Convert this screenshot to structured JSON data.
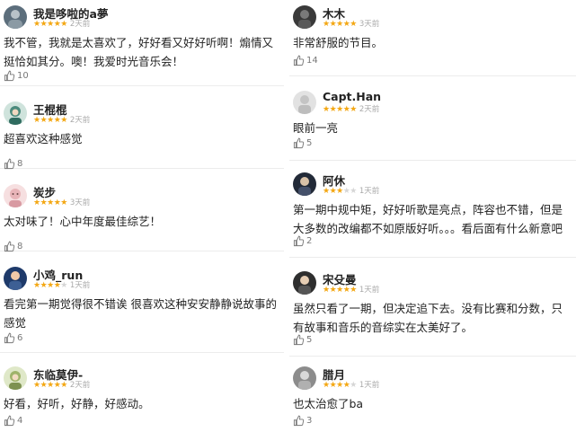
{
  "left": [
    {
      "user": "我是哆啦的a夢",
      "time": "2天前",
      "stars": 5,
      "text": "我不管，我就是太喜欢了，好好看又好好听啊！煽情又挺恰如其分。噢！我爱时光音乐会！",
      "likes": "10",
      "avatar_color": "#5c6e7c"
    },
    {
      "user": "王棍棍",
      "time": "2天前",
      "stars": 5,
      "text": "超喜欢这种感觉",
      "likes": "8",
      "avatar_color": "#4a8a7c"
    },
    {
      "user": "炭步",
      "time": "3天前",
      "stars": 5,
      "text": "太对味了！心中年度最佳综艺！",
      "likes": "8",
      "avatar_color": "#e8b4b8"
    },
    {
      "user": "小鸡_run",
      "time": "1天前",
      "stars": 4,
      "text": "看完第一期觉得很不错诶 很喜欢这种安安静静说故事的感觉",
      "likes": "6",
      "avatar_color": "#1e3a6a"
    },
    {
      "user": "东临莫伊-",
      "time": "2天前",
      "stars": 5,
      "text": "好看，好听，好静，好感动。",
      "likes": "4",
      "avatar_color": "#9fb36a"
    }
  ],
  "right": [
    {
      "user": "木木",
      "time": "3天前",
      "stars": 5,
      "text": "非常舒服的节目。",
      "likes": "14",
      "avatar_color": "#3a3a3a"
    },
    {
      "user": "Capt.Han",
      "time": "2天前",
      "stars": 5,
      "text": "眼前一亮",
      "likes": "5",
      "avatar_color": "#d8d8d8"
    },
    {
      "user": "阿休",
      "time": "1天前",
      "stars": 3,
      "text": "第一期中规中矩，好好听歌是亮点，阵容也不错，但是大多数的改编都不如原版好听。。。看后面有什么新意吧",
      "likes": "2",
      "avatar_color": "#222a38"
    },
    {
      "user": "宋殳曼",
      "time": "1天前",
      "stars": 5,
      "text": "虽然只看了一期，但决定追下去。没有比赛和分数，只有故事和音乐的音综实在太美好了。",
      "likes": "5",
      "avatar_color": "#2e2e2e"
    },
    {
      "user": "腊月",
      "time": "1天前",
      "stars": 4,
      "text": "也太治愈了ba",
      "likes": "3",
      "avatar_color": "#8c8c8c"
    }
  ]
}
